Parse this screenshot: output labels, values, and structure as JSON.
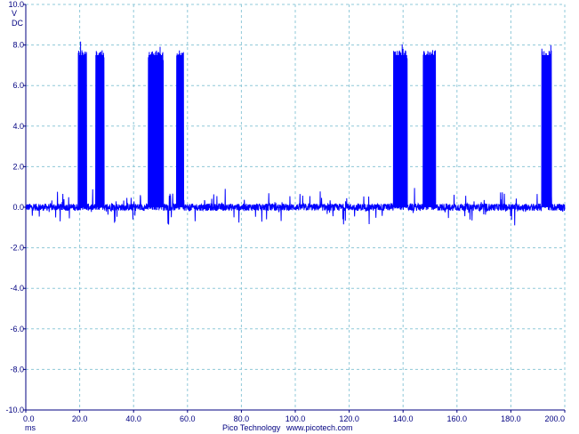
{
  "chart_data": {
    "type": "line",
    "title": "",
    "xlabel": "ms",
    "ylabel": "V",
    "y_unit_lines": [
      "V",
      "DC"
    ],
    "xlim": [
      0,
      200
    ],
    "ylim": [
      -10,
      10
    ],
    "x_ticks": [
      0,
      20,
      40,
      60,
      80,
      100,
      120,
      140,
      160,
      180,
      200
    ],
    "x_tick_labels": [
      "0.0",
      "20.0",
      "40.0",
      "60.0",
      "80.0",
      "100.0",
      "120.0",
      "140.0",
      "160.0",
      "180.0",
      "200.0"
    ],
    "y_ticks": [
      10,
      8,
      6,
      4,
      2,
      0,
      -2,
      -4,
      -6,
      -8,
      -10
    ],
    "y_tick_labels": [
      "10.0",
      "8.0",
      "6.0",
      "4.0",
      "2.0",
      "0.0",
      "-2.0",
      "-4.0",
      "-6.0",
      "-8.0",
      "-10.0"
    ],
    "grid": true,
    "legend": "none",
    "baseline_level": 0.0,
    "pulse_level": 7.5,
    "series": [
      {
        "color": "#0000ff",
        "pulses": [
          {
            "start": 19.5,
            "end": 22.5
          },
          {
            "start": 26.0,
            "end": 29.0
          },
          {
            "start": 45.5,
            "end": 51.0
          },
          {
            "start": 56.0,
            "end": 58.5
          },
          {
            "start": 136.5,
            "end": 141.5
          },
          {
            "start": 147.5,
            "end": 152.0
          },
          {
            "start": 191.5,
            "end": 195.0
          }
        ]
      }
    ]
  },
  "footer": {
    "brand": "Pico Technology",
    "url": "www.picotech.com"
  },
  "colors": {
    "trace": "#0000ff",
    "grid": "#8fc8d8",
    "axis": "#000080",
    "text": "#000080"
  }
}
